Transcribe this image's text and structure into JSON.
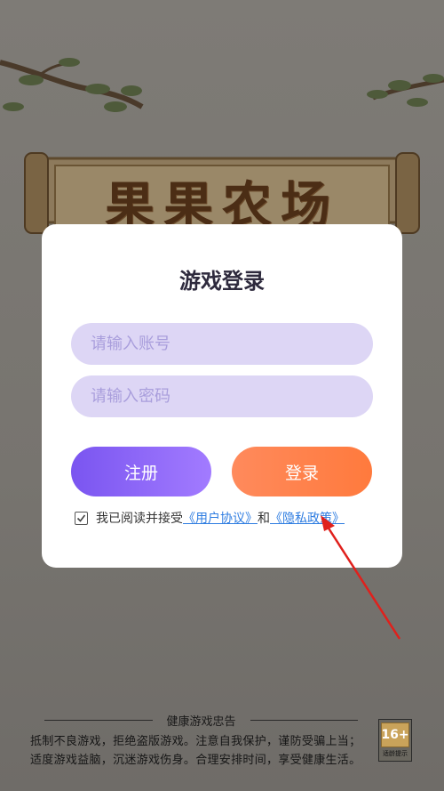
{
  "background": {
    "game_title": "果果农场"
  },
  "login_modal": {
    "title": "游戏登录",
    "account_placeholder": "请输入账号",
    "password_placeholder": "请输入密码",
    "register_label": "注册",
    "login_label": "登录",
    "agreement": {
      "checked": true,
      "prefix": "我已阅读并接受",
      "user_agreement_link": "《用户协议》",
      "conjunction": "和",
      "privacy_policy_link": "《隐私政策》"
    }
  },
  "footer": {
    "heading": "健康游戏忠告",
    "line1": "抵制不良游戏，拒绝盗版游戏。注意自我保护，谨防受骗上当；",
    "line2": "适度游戏益脑，沉迷游戏伤身。合理安排时间，享受健康生活。",
    "age_rating": "16+",
    "age_tip": "适龄提示"
  },
  "colors": {
    "register_button": "#8a64f8",
    "login_button": "#ff8248",
    "input_bg": "#ddd6f5",
    "link": "#2f7de1",
    "annotation_arrow": "#e0201c"
  }
}
